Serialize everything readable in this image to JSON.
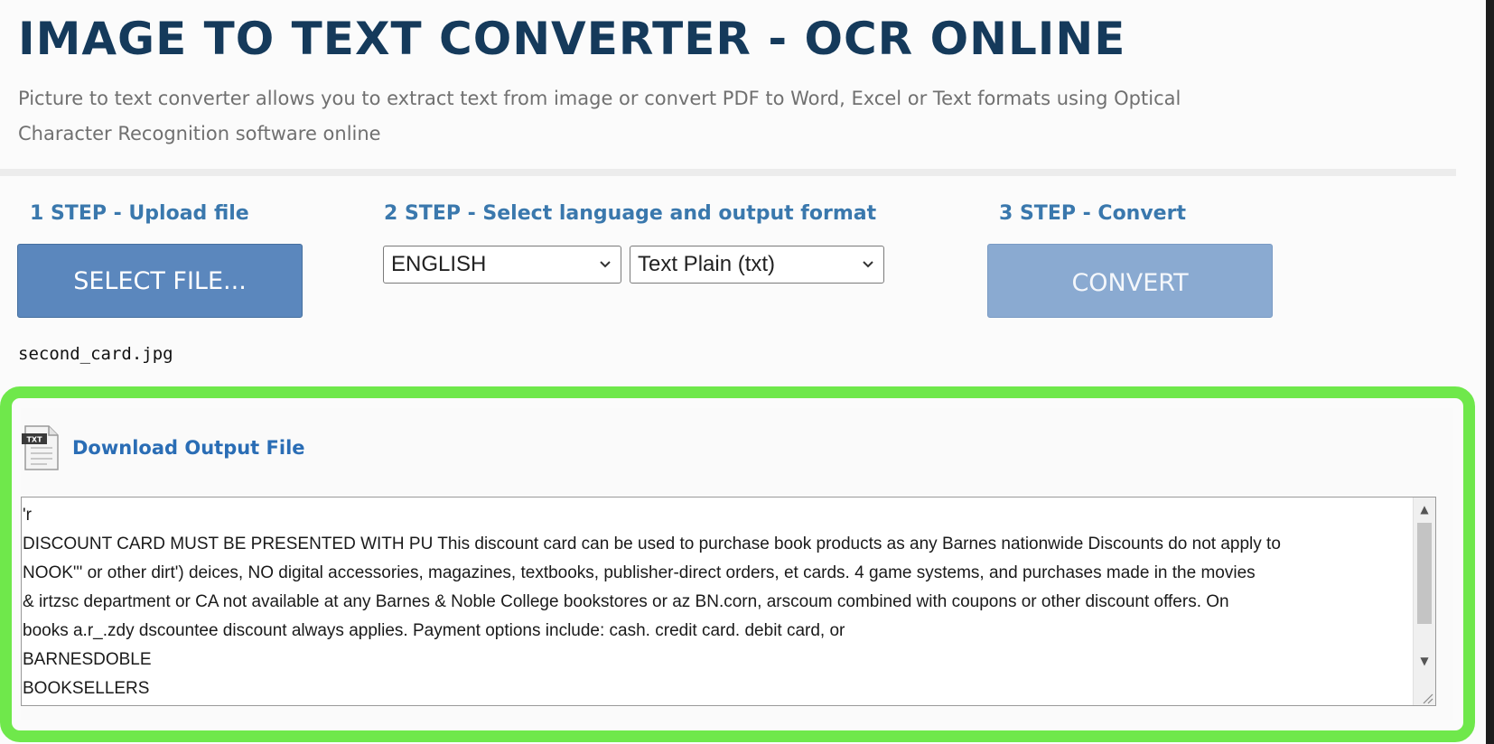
{
  "header": {
    "title": "IMAGE TO TEXT CONVERTER - OCR ONLINE",
    "subtitle": "Picture to text converter allows you to extract text from image or convert PDF to Word, Excel or Text formats using Optical Character Recognition software online"
  },
  "steps": {
    "step1_label": "1 STEP - Upload file",
    "step2_label": "2 STEP - Select language and output format",
    "step3_label": "3 STEP - Convert"
  },
  "upload": {
    "button_label": "SELECT FILE...",
    "filename": "second_card.jpg"
  },
  "options": {
    "language": "ENGLISH",
    "format": "Text Plain (txt)"
  },
  "convert": {
    "button_label": "CONVERT"
  },
  "result": {
    "file_icon_label": "TXT",
    "download_label": "Download Output File",
    "output_lines": [
      "'r",
      "DISCOUNT CARD MUST BE PRESENTED WITH PU This discount card can be used to purchase book products as any Barnes nationwide Discounts do not apply to",
      "NOOK\"' or other dirt') deices, NO digital accessories, magazines, textbooks, publisher-direct orders, et cards. 4 game systems, and purchases made in the movies",
      "& irtzsc department or CA not available at any Barnes & Noble College bookstores or az BN.corn, arscoum combined with coupons or other discount offers. On",
      "books a.r_.zdy dscountee discount always applies. Payment options include: cash. credit card. debit card, or",
      "BARNESDOBLE",
      "BOOKSELLERS"
    ]
  },
  "colors": {
    "title": "#153a5b",
    "step_label": "#3a78ad",
    "select_button": "#5b87bd",
    "convert_button": "#8aaad1",
    "highlight": "#6fe84b",
    "link": "#2a6db5"
  }
}
